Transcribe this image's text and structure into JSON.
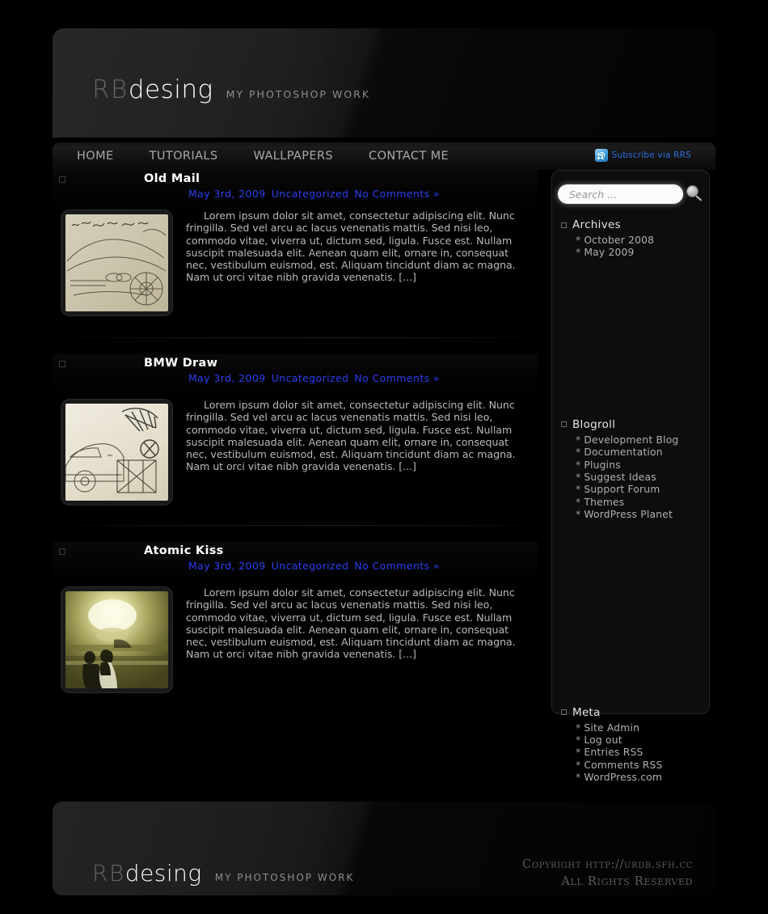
{
  "site": {
    "brand_rb": "RB",
    "brand_desing": "desing",
    "tagline": "my photoshop work"
  },
  "nav": {
    "items": [
      {
        "label": "HOME"
      },
      {
        "label": "TUTORIALS"
      },
      {
        "label": "WALLPAPERS"
      },
      {
        "label": "CONTACT ME"
      }
    ],
    "rss_label": "Subscribe via RRS",
    "rss_icon": "rss-icon"
  },
  "posts": [
    {
      "title": "Old Mail",
      "date": "May 3rd, 2009",
      "category": "Uncategorized",
      "comments": "No Comments »",
      "excerpt": "Lorem ipsum dolor sit amet, consectetur adipiscing elit. Nunc fringilla. Sed vel arcu ac lacus venenatis mattis. Sed nisi leo, commodo vitae, viverra ut, dictum sed, ligula. Fusce est. Nullam suscipit malesuada elit. Aenean quam elit, ornare in, consequat nec, vestibulum euismod, est. Aliquam tincidunt diam ac magna. Nam ut orci vitae nibh gravida venenatis. [...]",
      "thumb": "pencil-sketch-car-on-old-paper"
    },
    {
      "title": "BMW Draw",
      "date": "May 3rd, 2009",
      "category": "Uncategorized",
      "comments": "No Comments »",
      "excerpt": "Lorem ipsum dolor sit amet, consectetur adipiscing elit. Nunc fringilla. Sed vel arcu ac lacus venenatis mattis. Sed nisi leo, commodo vitae, viverra ut, dictum sed, ligula. Fusce est. Nullam suscipit malesuada elit. Aenean quam elit, ornare in, consequat nec, vestibulum euismod, est. Aliquam tincidunt diam ac magna. Nam ut orci vitae nibh gravida venenatis. [...]",
      "thumb": "pencil-sketch-bmw-car"
    },
    {
      "title": "Atomic Kiss",
      "date": "May 3rd, 2009",
      "category": "Uncategorized",
      "comments": "No Comments »",
      "excerpt": "Lorem ipsum dolor sit amet, consectetur adipiscing elit. Nunc fringilla. Sed vel arcu ac lacus venenatis mattis. Sed nisi leo, commodo vitae, viverra ut, dictum sed, ligula. Fusce est. Nullam suscipit malesuada elit. Aenean quam elit, ornare in, consequat nec, vestibulum euismod, est. Aliquam tincidunt diam ac magna. Nam ut orci vitae nibh gravida venenatis. [...]",
      "thumb": "sepia-couple-kissing-nuclear-blast"
    }
  ],
  "sidebar": {
    "search": {
      "placeholder": "Search ...",
      "value": "",
      "button_icon": "magnifier-icon"
    },
    "widgets": [
      {
        "title": "Archives",
        "items": [
          "October 2008",
          "May 2009"
        ]
      },
      {
        "title": "Blogroll",
        "items": [
          "Development Blog",
          "Documentation",
          "Plugins",
          "Suggest Ideas",
          "Support Forum",
          "Themes",
          "WordPress Planet"
        ]
      },
      {
        "title": "Meta",
        "items": [
          "Site Admin",
          "Log out",
          "Entries RSS",
          "Comments RSS",
          "WordPress.com"
        ]
      }
    ],
    "bullet_marker": "*"
  },
  "footer": {
    "copyright_line1": "Copyright http://urdb.sfh.cc",
    "copyright_line2": "All Rights Reserved"
  },
  "colors": {
    "page_background": "#000000",
    "panel": "#0d0d0d",
    "link_blue": "#2b3ff0",
    "rss_blue": "#2b6fe0",
    "body_text": "#b9b9b9",
    "heading_text": "#ffffff"
  }
}
